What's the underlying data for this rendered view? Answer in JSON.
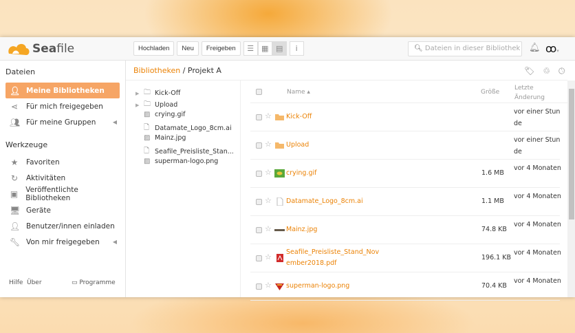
{
  "app": {
    "name_bold": "Sea",
    "name_rest": "file"
  },
  "toolbar": {
    "upload": "Hochladen",
    "new": "Neu",
    "share": "Freigeben"
  },
  "search": {
    "placeholder": "Dateien in dieser Bibliothek"
  },
  "sidebar": {
    "files_heading": "Dateien",
    "tools_heading": "Werkzeuge",
    "files": [
      {
        "label": "Meine Bibliotheken"
      },
      {
        "label": "Für mich freigegeben"
      },
      {
        "label": "Für meine Gruppen"
      }
    ],
    "tools": [
      {
        "label": "Favoriten"
      },
      {
        "label": "Aktivitäten"
      },
      {
        "label": "Veröffentlichte Bibliotheken"
      },
      {
        "label": "Geräte"
      },
      {
        "label": "Benutzer/innen einladen"
      },
      {
        "label": "Von mir freigegeben"
      }
    ],
    "footer": {
      "help": "Hilfe",
      "about": "Über",
      "clients": "Programme"
    }
  },
  "breadcrumb": {
    "root": "Bibliotheken",
    "sep": "/",
    "current": "Projekt A"
  },
  "tree": [
    "Kick-Off",
    "Upload",
    "crying.gif",
    "Datamate_Logo_8cm.ai",
    "Mainz.jpg",
    "Seafile_Preisliste_Stan...",
    "superman-logo.png"
  ],
  "table": {
    "headers": {
      "name": "Name ▴",
      "size": "Größe",
      "modified_1": "Letzte",
      "modified_2": "Änderung"
    },
    "rows": [
      {
        "name": "Kick-Off",
        "size": "",
        "date": "vor einer Stunde",
        "type": "folder"
      },
      {
        "name": "Upload",
        "size": "",
        "date": "vor einer Stunde",
        "type": "folder"
      },
      {
        "name": "crying.gif",
        "size": "1.6 MB",
        "date": "vor 4 Monaten",
        "type": "gif"
      },
      {
        "name": "Datamate_Logo_8cm.ai",
        "size": "1.1 MB",
        "date": "vor 4 Monaten",
        "type": "file"
      },
      {
        "name": "Mainz.jpg",
        "size": "74.8 KB",
        "date": "vor 4 Monaten",
        "type": "jpg"
      },
      {
        "name": "Seafile_Preisliste_Stand_November2018.pdf",
        "size": "196.1 KB",
        "date": "vor 4 Monaten",
        "type": "pdf"
      },
      {
        "name": "superman-logo.png",
        "size": "70.4 KB",
        "date": "vor 4 Monaten",
        "type": "png"
      }
    ]
  },
  "colors": {
    "accent": "#eb8205",
    "active": "#f6a565"
  }
}
